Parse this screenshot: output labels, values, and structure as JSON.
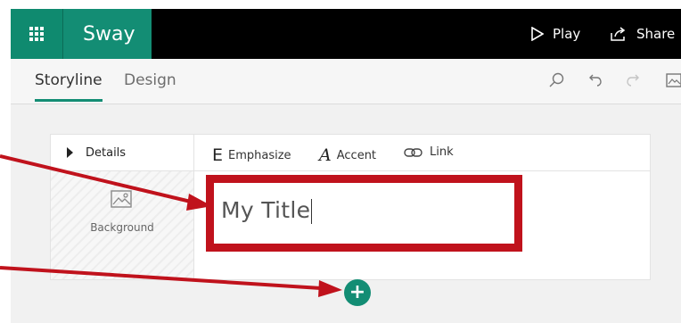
{
  "app": {
    "name": "Sway"
  },
  "topbar": {
    "play_label": "Play",
    "share_label": "Share"
  },
  "tabs": [
    {
      "label": "Storyline",
      "active": true
    },
    {
      "label": "Design",
      "active": false
    }
  ],
  "toolbar_icons": [
    "search-icon",
    "undo-icon",
    "redo-icon",
    "image-icon"
  ],
  "card": {
    "details_label": "Details",
    "background_label": "Background",
    "format_buttons": [
      {
        "glyph": "E",
        "label": "Emphasize"
      },
      {
        "glyph": "A",
        "label": "Accent"
      },
      {
        "icon": "link-icon",
        "label": "Link"
      }
    ],
    "title_text": "My Title"
  },
  "add_button": {
    "glyph": "+"
  },
  "colors": {
    "accent": "#138d74",
    "highlight": "#c0121c",
    "topbar": "#000000"
  }
}
